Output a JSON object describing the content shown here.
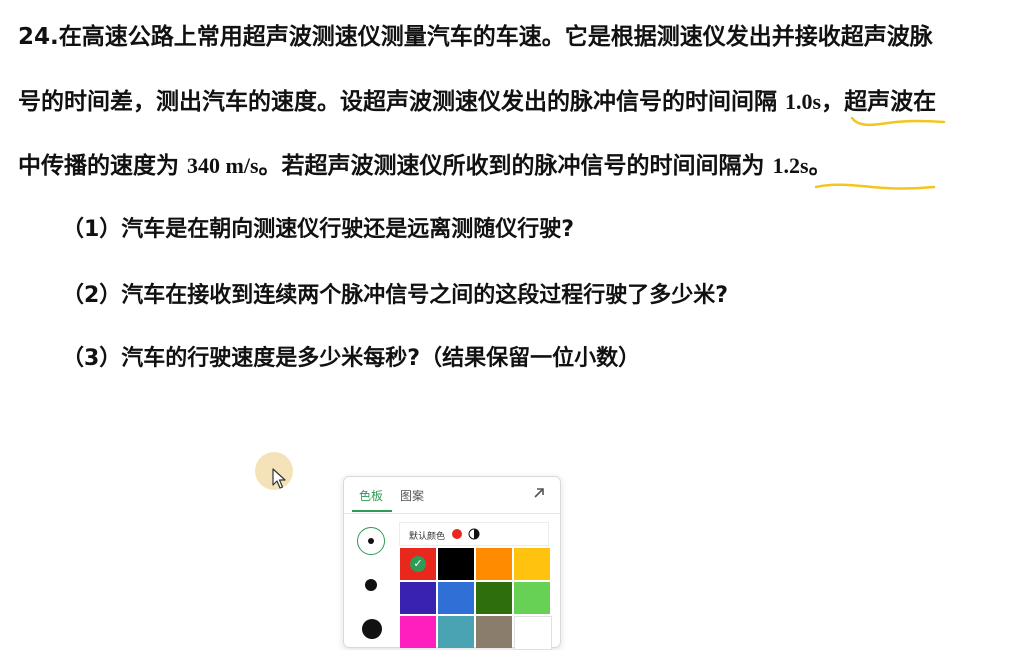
{
  "question": {
    "line1": "24.在高速公路上常用超声波测速仪测量汽车的车速。它是根据测速仪发出并接收超声波脉",
    "line2_a": "号的时间差，测出汽车的速度。设超声波测速仪发出的脉冲信号的时间间隔 ",
    "line2_val": "1.0s",
    "line2_b": "，超声波在",
    "line3_a": "中传播的速度为 ",
    "line3_val1": "340 m/s",
    "line3_b": "。若超声波测速仪所收到的脉冲信号的时间间隔为 ",
    "line3_val2": "1.2s",
    "line3_c": "。",
    "sub1": "（1）汽车是在朝向测速仪行驶还是远离测随仪行驶?",
    "sub2": "（2）汽车在接收到连续两个脉冲信号之间的这段过程行驶了多少米?",
    "sub3": "（3）汽车的行驶速度是多少米每秒?（结果保留一位小数）"
  },
  "color_panel": {
    "tab_palette": "色板",
    "tab_pattern": "图案",
    "default_color_label": "默认颜色",
    "expand_icon": "arrow-up-right-icon",
    "selected_swatch": 0,
    "swatches": [
      "#e8281d",
      "#000000",
      "#ff8c00",
      "#ffc20e",
      "#3a22b0",
      "#2f6fd6",
      "#2f6e0d",
      "#66d155",
      "#ff1fbf",
      "#4aa3b3",
      "#8b7d6b",
      "#ffffff"
    ],
    "brush_sizes": [
      "small",
      "medium",
      "large"
    ],
    "selected_brush_size": "small"
  },
  "colors": {
    "accent": "#2e9b57",
    "annotation": "#f4c51c"
  }
}
